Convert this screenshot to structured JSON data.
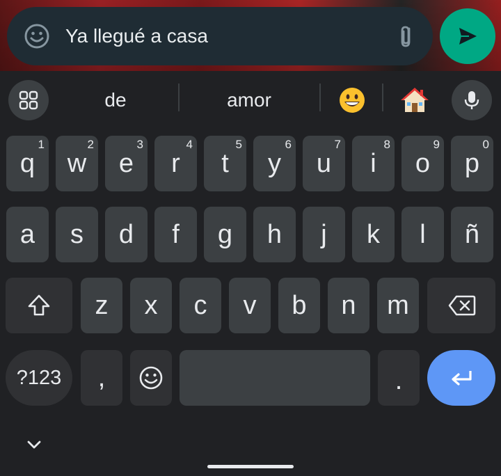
{
  "compose": {
    "text": "Ya llegué a casa",
    "emoji_icon": "emoji-smiley-icon",
    "attach_icon": "paperclip-icon"
  },
  "send": {
    "icon": "send-arrow-icon",
    "color": "#00a884"
  },
  "suggestions": {
    "menu_icon": "grid-menu-icon",
    "words": [
      "de",
      "amor"
    ],
    "emoji_1": "grinning-face-emoji",
    "emoji_2": "house-emoji",
    "mic_icon": "microphone-icon"
  },
  "keyboard": {
    "row1": [
      {
        "label": "q",
        "hint": "1"
      },
      {
        "label": "w",
        "hint": "2"
      },
      {
        "label": "e",
        "hint": "3"
      },
      {
        "label": "r",
        "hint": "4"
      },
      {
        "label": "t",
        "hint": "5"
      },
      {
        "label": "y",
        "hint": "6"
      },
      {
        "label": "u",
        "hint": "7"
      },
      {
        "label": "i",
        "hint": "8"
      },
      {
        "label": "o",
        "hint": "9"
      },
      {
        "label": "p",
        "hint": "0"
      }
    ],
    "row2": [
      "a",
      "s",
      "d",
      "f",
      "g",
      "h",
      "j",
      "k",
      "l",
      "ñ"
    ],
    "row3": [
      "z",
      "x",
      "c",
      "v",
      "b",
      "n",
      "m"
    ],
    "symbols_label": "?123",
    "comma_label": ",",
    "period_label": ".",
    "shift_icon": "shift-arrow-icon",
    "backspace_icon": "backspace-icon",
    "emoji_key_icon": "emoji-smiley-icon",
    "enter_icon": "enter-return-icon",
    "enter_color": "#5e97f6"
  },
  "nav": {
    "collapse_icon": "chevron-down-icon"
  }
}
